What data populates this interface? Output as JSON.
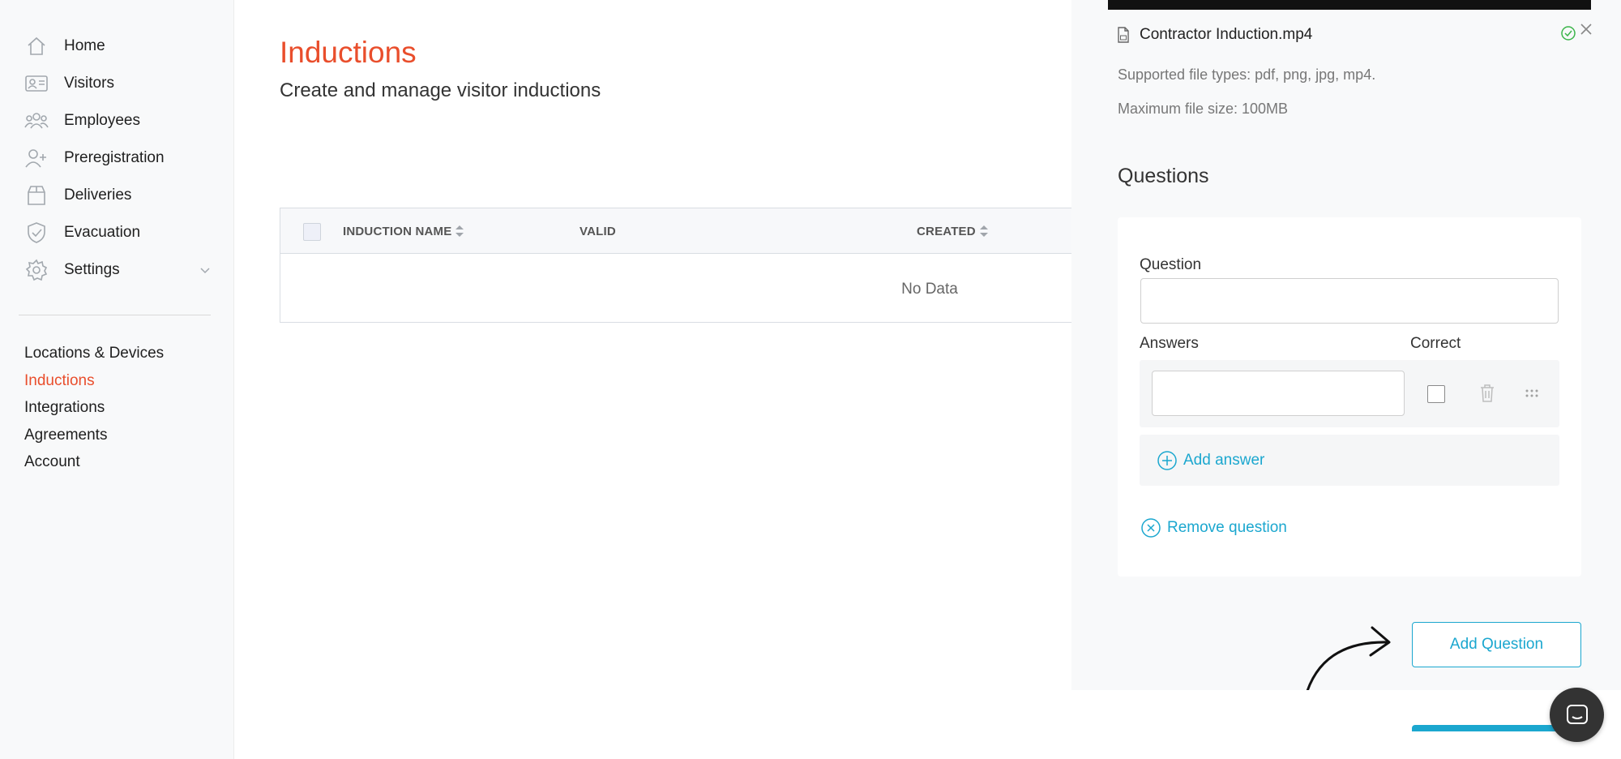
{
  "sidebar": {
    "items": [
      {
        "label": "Home",
        "icon": "home-icon"
      },
      {
        "label": "Visitors",
        "icon": "id-card-icon"
      },
      {
        "label": "Employees",
        "icon": "people-icon"
      },
      {
        "label": "Preregistration",
        "icon": "user-plus-icon"
      },
      {
        "label": "Deliveries",
        "icon": "box-icon"
      },
      {
        "label": "Evacuation",
        "icon": "shield-check-icon"
      },
      {
        "label": "Settings",
        "icon": "gear-icon"
      }
    ],
    "sub_items": [
      {
        "label": "Locations & Devices"
      },
      {
        "label": "Inductions",
        "active": true
      },
      {
        "label": "Integrations"
      },
      {
        "label": "Agreements"
      },
      {
        "label": "Account"
      }
    ]
  },
  "page": {
    "title": "Inductions",
    "subtitle": "Create and manage visitor inductions"
  },
  "table": {
    "columns": [
      "INDUCTION NAME",
      "VALID",
      "CREATED"
    ],
    "empty_text": "No Data"
  },
  "drawer": {
    "file_name": "Contractor Induction.mp4",
    "supported_types": "Supported file types: pdf, png, jpg, mp4.",
    "max_size": "Maximum file size: 100MB",
    "questions_heading": "Questions",
    "question_label": "Question",
    "question_value": "",
    "answers_label": "Answers",
    "correct_label": "Correct",
    "answer_value": "",
    "add_answer": "Add answer",
    "remove_question": "Remove question",
    "add_question_button": "Add Question"
  },
  "colors": {
    "accent": "#e94e2c",
    "link": "#1ba7cf",
    "success": "#3bb54a"
  }
}
